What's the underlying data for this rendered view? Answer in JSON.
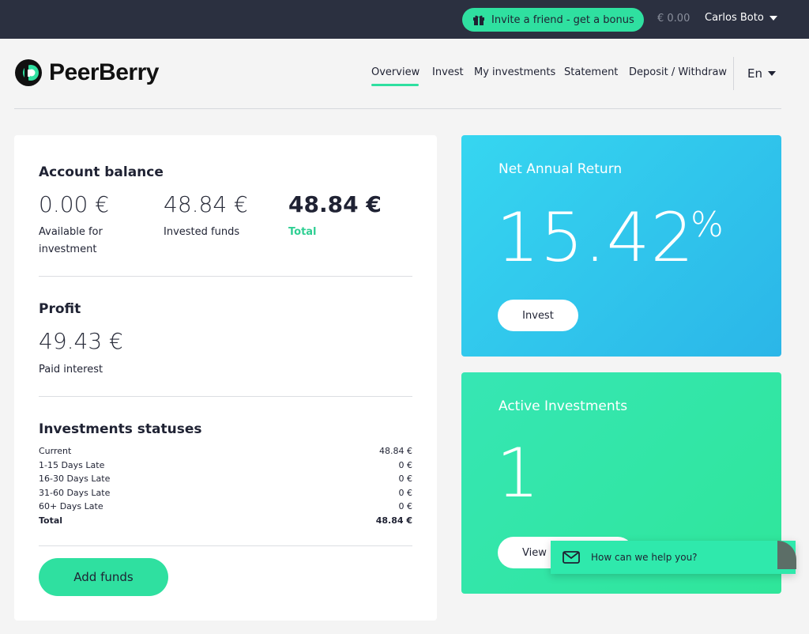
{
  "topbar": {
    "invite_label": "Invite a friend - get a bonus",
    "balance": "€ 0.00",
    "user_name": "Carlos Boto"
  },
  "brand": {
    "name": "PeerBerry"
  },
  "nav": {
    "items": [
      "Overview",
      "Invest",
      "My investments",
      "Statement",
      "Deposit / Withdraw"
    ],
    "active": "Overview",
    "language": "En"
  },
  "account": {
    "title": "Account balance",
    "available_value": "0.00 €",
    "available_label": "Available for investment",
    "invested_value": "48.84 €",
    "invested_label": "Invested funds",
    "total_value": "48.84 €",
    "total_label": "Total"
  },
  "profit": {
    "title": "Profit",
    "value": "49.43 €",
    "label": "Paid interest"
  },
  "statuses": {
    "title": "Investments statuses",
    "rows": [
      {
        "label": "Current",
        "value": "48.84 €"
      },
      {
        "label": "1-15 Days Late",
        "value": "0 €"
      },
      {
        "label": "16-30 Days Late",
        "value": "0 €"
      },
      {
        "label": "31-60 Days Late",
        "value": "0 €"
      },
      {
        "label": "60+ Days Late",
        "value": "0 €"
      }
    ],
    "total_label": "Total",
    "total_value": "48.84 €"
  },
  "add_funds_label": "Add funds",
  "net_return": {
    "title": "Net Annual Return",
    "value": "15.42",
    "unit": "%",
    "button": "Invest"
  },
  "active_investments": {
    "title": "Active Investments",
    "value": "1",
    "button": "View"
  },
  "chat": {
    "text": "How can we help you?"
  },
  "colors": {
    "accent": "#2fe0a0",
    "topbar": "#2b3040",
    "blue_card": "#2bc5ee",
    "green_card": "#33e6a8"
  }
}
